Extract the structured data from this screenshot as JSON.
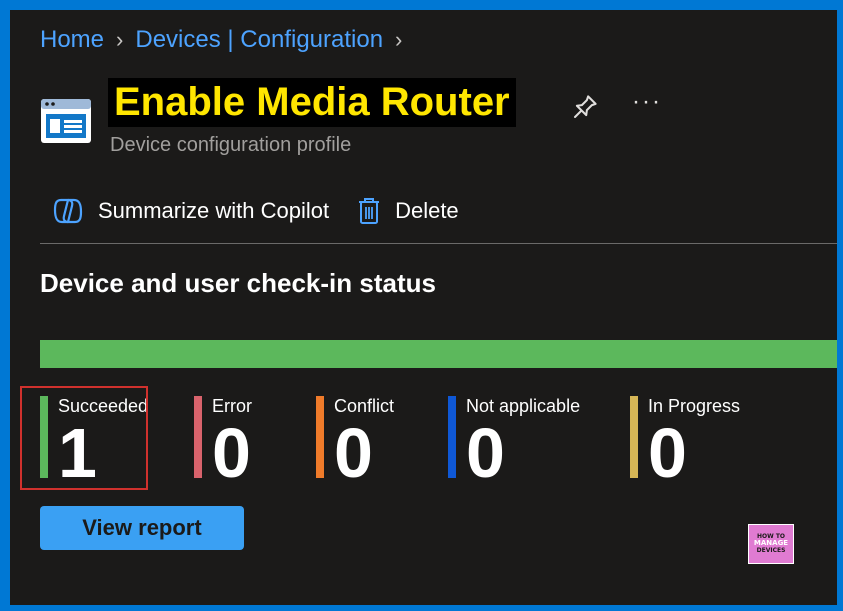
{
  "breadcrumb": {
    "home": "Home",
    "parent": "Devices | Configuration"
  },
  "header": {
    "title": "Enable Media Router",
    "subtitle": "Device configuration profile",
    "more_label": "···"
  },
  "toolbar": {
    "copilot_label": "Summarize with Copilot",
    "delete_label": "Delete"
  },
  "section": {
    "title": "Device and user check-in status"
  },
  "progress": {
    "succeeded_fraction": 1.0
  },
  "stats": [
    {
      "label": "Succeeded",
      "value": "1",
      "color": "#5cb85c"
    },
    {
      "label": "Error",
      "value": "0",
      "color": "#d9636c"
    },
    {
      "label": "Conflict",
      "value": "0",
      "color": "#f07b2a"
    },
    {
      "label": "Not applicable",
      "value": "0",
      "color": "#0f58d6"
    },
    {
      "label": "In Progress",
      "value": "0",
      "color": "#d6b656"
    }
  ],
  "actions": {
    "view_report_label": "View report"
  },
  "logo": {
    "line1": "HOW TO",
    "line2": "MANAGE",
    "line3": "DEVICES"
  },
  "colors": {
    "accent": "#0078d4",
    "link": "#4da3ff",
    "title": "#ffe600",
    "highlight": "#d0312d"
  }
}
